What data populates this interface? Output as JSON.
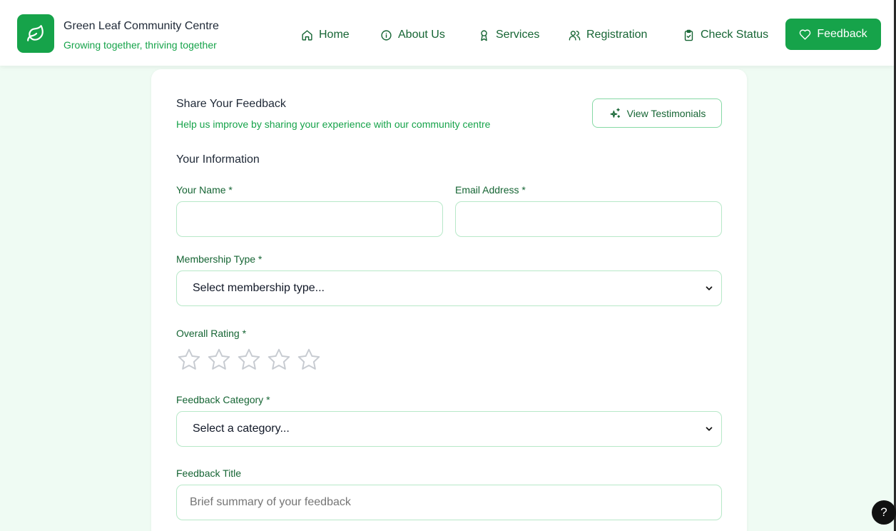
{
  "brand": {
    "title": "Green Leaf Community Centre",
    "subtitle": "Growing together, thriving together"
  },
  "nav": {
    "home": "Home",
    "about": "About Us",
    "services": "Services",
    "registration": "Registration",
    "check_status": "Check Status",
    "feedback": "Feedback"
  },
  "card": {
    "title": "Share Your Feedback",
    "subtitle": "Help us improve by sharing your experience with our community centre",
    "testimonials_button": "View Testimonials",
    "section_heading": "Your Information"
  },
  "form": {
    "name_label": "Your Name *",
    "name_value": "",
    "email_label": "Email Address *",
    "email_value": "",
    "membership_label": "Membership Type *",
    "membership_selected": "Select membership type...",
    "rating_label": "Overall Rating *",
    "rating_value": 0,
    "rating_max": 5,
    "category_label": "Feedback Category *",
    "category_selected": "Select a category...",
    "title_label": "Feedback Title",
    "title_placeholder": "Brief summary of your feedback",
    "title_value": ""
  },
  "help": {
    "label": "?"
  },
  "colors": {
    "accent": "#16a34a",
    "accent_dark": "#166534",
    "page_bg": "#effbf3",
    "field_border": "#b7e8c8",
    "star_outline": "#c7cbd1"
  }
}
